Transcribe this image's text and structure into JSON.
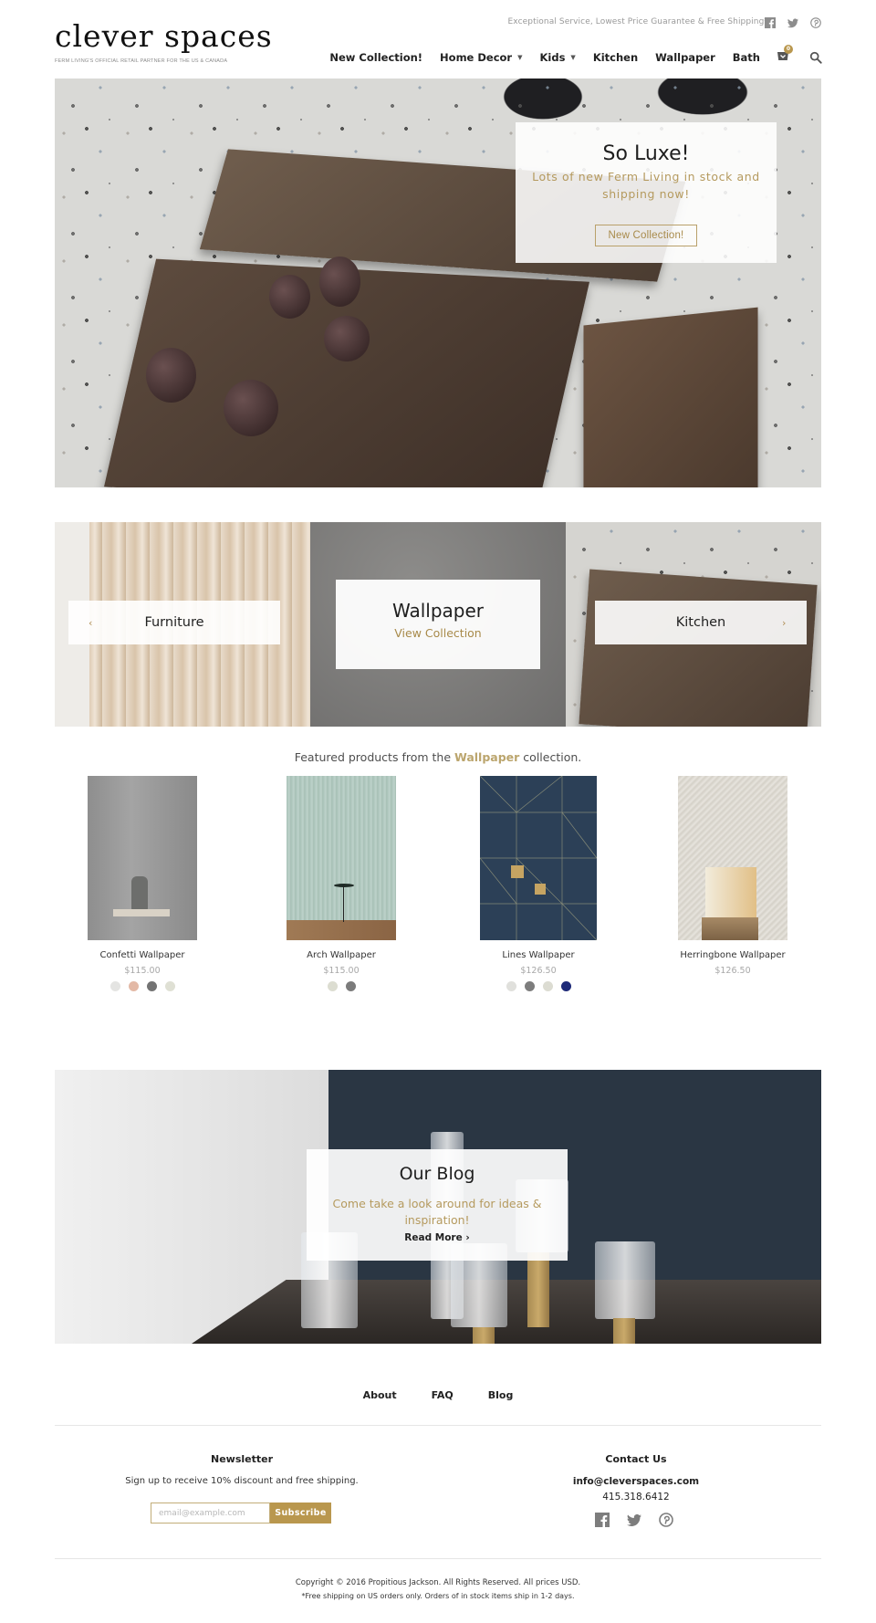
{
  "header": {
    "logo": "clever spaces",
    "tagline": "Ferm Living's official retail partner for the US & Canada",
    "promo": "Exceptional Service, Lowest Price Guarantee & Free Shipping*",
    "social": [
      "facebook-icon",
      "twitter-icon",
      "pinterest-icon"
    ],
    "nav": [
      {
        "label": "New Collection!",
        "dropdown": false
      },
      {
        "label": "Home Decor",
        "dropdown": true
      },
      {
        "label": "Kids",
        "dropdown": true
      },
      {
        "label": "Kitchen",
        "dropdown": false
      },
      {
        "label": "Wallpaper",
        "dropdown": false
      },
      {
        "label": "Bath",
        "dropdown": false
      }
    ],
    "cart_count": "0",
    "caret": "▼"
  },
  "hero": {
    "title": "So Luxe!",
    "subtitle": "Lots of new Ferm Living in stock and shipping now!",
    "button": "New Collection!"
  },
  "categories": {
    "prev_arrow": "‹",
    "next_arrow": "›",
    "left": "Furniture",
    "center_title": "Wallpaper",
    "center_link": "View Collection",
    "right": "Kitchen"
  },
  "featured": {
    "prefix": "Featured products from the ",
    "collection": "Wallpaper",
    "suffix": " collection.",
    "products": [
      {
        "name": "Confetti Wallpaper",
        "price": "$115.00",
        "swatches": [
          "#e4e4e2",
          "#e3b9a6",
          "#737373",
          "#dfe0d4"
        ]
      },
      {
        "name": "Arch Wallpaper",
        "price": "$115.00",
        "swatches": [
          "#dcddd1",
          "#7b7b7b"
        ]
      },
      {
        "name": "Lines Wallpaper",
        "price": "$126.50",
        "swatches": [
          "#e0e0dc",
          "#7d7d7d",
          "#dcdcd2",
          "#1e2a78"
        ]
      },
      {
        "name": "Herringbone Wallpaper",
        "price": "$126.50",
        "swatches": []
      }
    ]
  },
  "blog": {
    "title": "Our Blog",
    "subtitle": "Come take a look around for ideas & inspiration!",
    "link": "Read More ›"
  },
  "footer": {
    "links": [
      "About",
      "FAQ",
      "Blog"
    ],
    "newsletter": {
      "title": "Newsletter",
      "text": "Sign up to receive 10% discount and free shipping.",
      "placeholder": "email@example.com",
      "button": "Subscribe"
    },
    "contact": {
      "title": "Contact Us",
      "email": "info@cleverspaces.com",
      "phone": "415.318.6412",
      "social": [
        "facebook-icon",
        "twitter-icon",
        "pinterest-icon"
      ]
    },
    "copyright": "Copyright © 2016 Propitious Jackson. All Rights Reserved. All prices USD.",
    "shipping_note": "*Free shipping on US orders only. Orders of in stock items ship in 1-2 days."
  },
  "colors": {
    "accent": "#b9974e",
    "accent_text": "#b59a5e",
    "text": "#222222",
    "muted": "#999999"
  }
}
